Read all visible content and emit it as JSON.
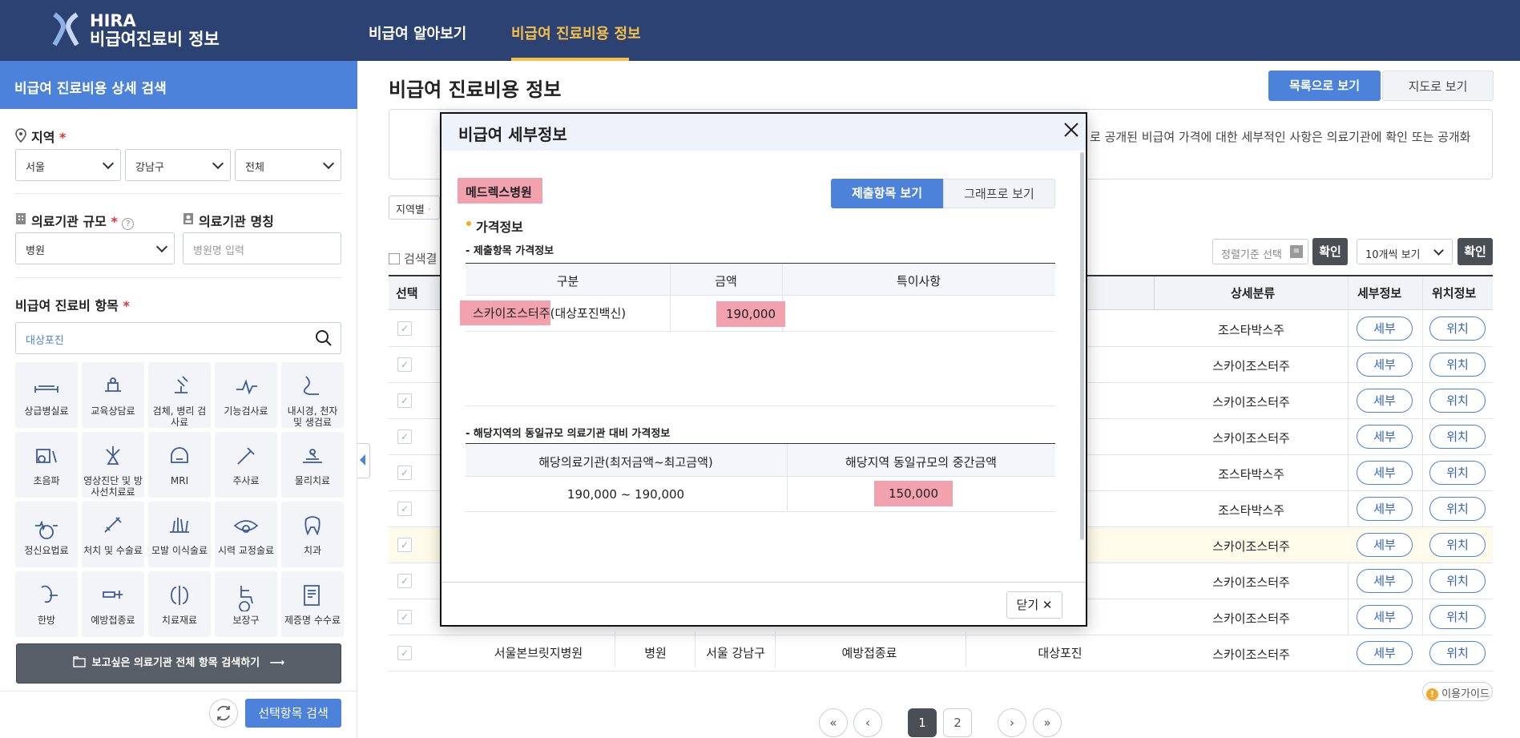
{
  "header": {
    "logo_line1": "HIRA",
    "logo_line2": "비급여진료비 정보",
    "nav_items": [
      "비급여 알아보기",
      "비급여 진료비용 정보"
    ],
    "active_nav": "비급여 진료비용 정보"
  },
  "sidebar": {
    "title": "비급여 진료비용 상세 검색",
    "region_label": "지역",
    "region_values": [
      "서울",
      "강남구",
      "전체"
    ],
    "scale_label": "의료기관 규모",
    "scale_value": "병원",
    "name_label": "의료기관 명칭",
    "name_placeholder": "병원명 입력",
    "item_label": "비급여 진료비 항목",
    "item_search_value": "대상포진",
    "tiles": [
      {
        "icon": "bed-icon",
        "label": "상급병실료"
      },
      {
        "icon": "counseling-icon",
        "label": "교육상담료"
      },
      {
        "icon": "microscope-icon",
        "label": "검체, 병리 검사료"
      },
      {
        "icon": "function-test-icon",
        "label": "기능검사료"
      },
      {
        "icon": "endoscope-icon",
        "label": "내시경, 천자 및 생검료"
      },
      {
        "icon": "ultrasound-icon",
        "label": "초음파"
      },
      {
        "icon": "radiology-icon",
        "label": "영상진단 및 방사선치료료"
      },
      {
        "icon": "mri-icon",
        "label": "MRI"
      },
      {
        "icon": "syringe-icon",
        "label": "주사료"
      },
      {
        "icon": "physical-therapy-icon",
        "label": "물리치료"
      },
      {
        "icon": "psychiatry-icon",
        "label": "정신요법료"
      },
      {
        "icon": "surgery-icon",
        "label": "처치 및 수술료"
      },
      {
        "icon": "hair-transplant-icon",
        "label": "모발 이식술료"
      },
      {
        "icon": "eye-icon",
        "label": "시력 교정술료"
      },
      {
        "icon": "tooth-icon",
        "label": "치과"
      },
      {
        "icon": "oriental-medicine-icon",
        "label": "한방"
      },
      {
        "icon": "vaccine-icon",
        "label": "예방접종료"
      },
      {
        "icon": "material-icon",
        "label": "치료재료"
      },
      {
        "icon": "wheelchair-icon",
        "label": "보장구"
      },
      {
        "icon": "certificate-icon",
        "label": "제증명 수수료"
      }
    ],
    "all_search_label": "보고싶은 의료기관 전체 항목 검색하기",
    "search_selected_label": "선택항목 검색"
  },
  "main": {
    "title": "비급여 진료비용 정보",
    "view_list": "목록으로 보기",
    "view_map": "지도로 보기",
    "notice_text": "로 공개된 비급여 가격에 대한 세부적인 사항은 의료기관에 확인 또는 공개화",
    "chip_label": "지역별",
    "results_label": "검색결",
    "sort_placeholder": "정렬기준 선택",
    "confirm": "확인",
    "per_page": "10개씩 보기",
    "columns": [
      "선택",
      "상세분류",
      "세부정보",
      "위치정보"
    ],
    "detail_btn": "세부",
    "location_btn": "위치",
    "rows": [
      {
        "sub": "조스타박스주"
      },
      {
        "sub": "스카이조스터주"
      },
      {
        "sub": "스카이조스터주"
      },
      {
        "sub": "스카이조스터주"
      },
      {
        "sub": "조스타박스주"
      },
      {
        "sub": "조스타박스주"
      },
      {
        "sub": "스카이조스터주"
      },
      {
        "sub": "스카이조스터주"
      },
      {
        "sub": "스카이조스터주"
      },
      {
        "sub": "스카이조스터주"
      }
    ],
    "last_row": {
      "name": "서울본브릿지병원",
      "type": "병원",
      "region": "서울 강남구",
      "category": "예방접종료",
      "item": "대상포진"
    },
    "guide": "이용가이드",
    "pages": [
      "1",
      "2"
    ]
  },
  "modal": {
    "title": "비급여 세부정보",
    "hospital": "메드렉스병원",
    "tab_submitted": "제출항목 보기",
    "tab_graph": "그래프로 보기",
    "section_title": "가격정보",
    "sub1": "- 제출항목 가격정보",
    "table1_headers": [
      "구분",
      "금액",
      "특이사항"
    ],
    "table1_row": {
      "name_hl": "스카이조스터주",
      "name_rest": "(대상포진백신)",
      "amount": "190,000",
      "note": ""
    },
    "sub2": "- 해당지역의 동일규모 의료기관 대비 가격정보",
    "table2_headers": [
      "해당의료기관(최저금액~최고금액)",
      "해당지역 동일규모의 중간금액"
    ],
    "table2_row": {
      "range": "190,000 ~ 190,000",
      "median": "150,000"
    },
    "close_label": "닫기"
  },
  "colors": {
    "header_bg": "#2b4272",
    "accent": "#4c82d9",
    "nav_active": "#f5c04a",
    "highlight": "#f2a1ae"
  }
}
